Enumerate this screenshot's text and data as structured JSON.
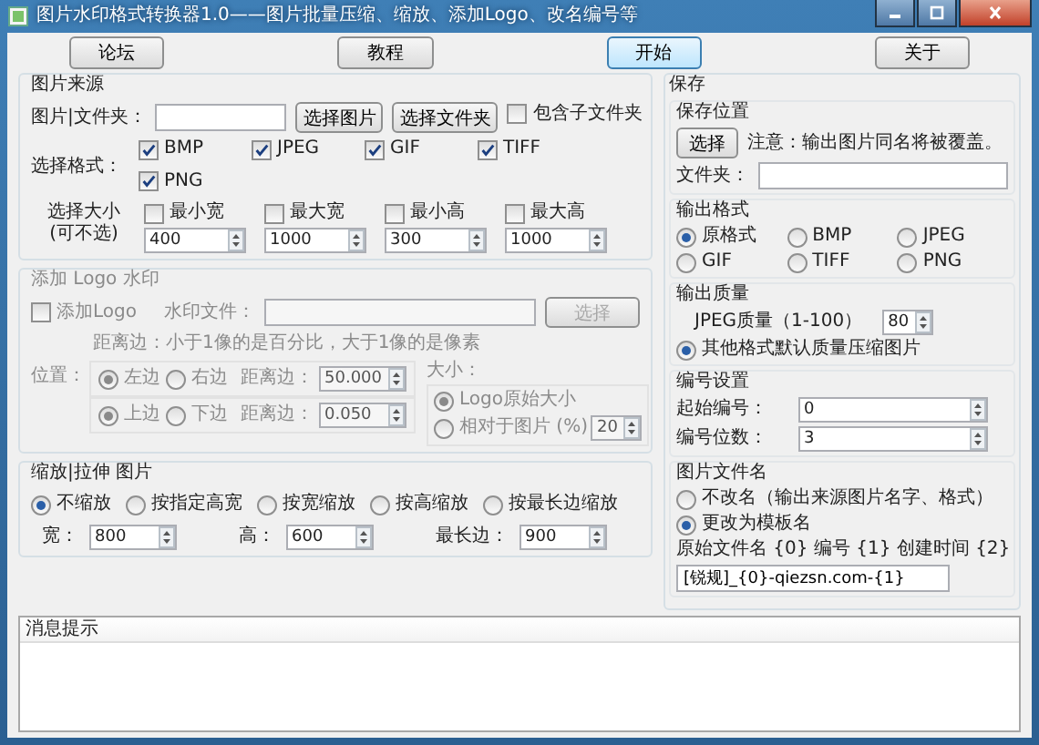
{
  "window": {
    "title": "图片水印格式转换器1.0——图片批量压缩、缩放、添加Logo、改名编号等"
  },
  "toolbar": [
    {
      "label": "论坛",
      "focused": false
    },
    {
      "label": "教程",
      "focused": false
    },
    {
      "label": "开始",
      "focused": true
    },
    {
      "label": "关于",
      "focused": false
    }
  ],
  "source": {
    "title": "图片来源",
    "path_label": "图片|文件夹：",
    "buttons": [
      "选择图片",
      "选择文件夹"
    ],
    "subfolders": {
      "label": "包含子文件夹",
      "checked": false
    },
    "format_label": "选择格式：",
    "formats": [
      {
        "label": "BMP",
        "checked": true
      },
      {
        "label": "JPEG",
        "checked": true
      },
      {
        "label": "GIF",
        "checked": true
      },
      {
        "label": "TIFF",
        "checked": true
      },
      {
        "label": "PNG",
        "checked": true
      }
    ],
    "size_label": "选择大小",
    "size_hint": "(可不选)",
    "sizes": [
      {
        "label": "最小宽",
        "checked": false,
        "value": "400"
      },
      {
        "label": "最大宽",
        "checked": false,
        "value": "1000"
      },
      {
        "label": "最小高",
        "checked": false,
        "value": "300"
      },
      {
        "label": "最大高",
        "checked": false,
        "value": "1000"
      }
    ]
  },
  "logo": {
    "title": "添加 Logo 水印",
    "disabled": true,
    "enable": {
      "label": "添加Logo",
      "checked": false
    },
    "file_label": "水印文件：",
    "button": "选择",
    "position_label": "位置：",
    "hint": "距离边：小于1像的是百分比，大于1像的是像素",
    "rows": [
      {
        "options": [
          {
            "label": "左边",
            "selected": true
          },
          {
            "label": "右边",
            "selected": false
          }
        ],
        "distance_label": "距离边：",
        "value": "50.000"
      },
      {
        "options": [
          {
            "label": "上边",
            "selected": true
          },
          {
            "label": "下边",
            "selected": false
          }
        ],
        "distance_label": "距离边：",
        "value": "0.050"
      }
    ],
    "size_label": "大小：",
    "size_options": [
      {
        "label": "Logo原始大小",
        "selected": true
      },
      {
        "label": "相对于图片 (%)",
        "selected": false
      }
    ],
    "size_value": "20"
  },
  "scale": {
    "title": "缩放|拉伸 图片",
    "modes": [
      {
        "label": "不缩放",
        "selected": true
      },
      {
        "label": "按指定高宽",
        "selected": false
      },
      {
        "label": "按宽缩放",
        "selected": false
      },
      {
        "label": "按高缩放",
        "selected": false
      },
      {
        "label": "按最长边缩放",
        "selected": false
      }
    ],
    "fields": [
      {
        "label": "宽：",
        "value": "800"
      },
      {
        "label": "高：",
        "value": "600"
      },
      {
        "label": "最长边：",
        "value": "900"
      }
    ]
  },
  "save": {
    "title": "保存",
    "location": {
      "title": "保存位置",
      "button": "选择",
      "note": "注意：输出图片同名将被覆盖。",
      "folder_label": "文件夹："
    },
    "output_format": {
      "title": "输出格式",
      "options": [
        {
          "label": "原格式",
          "selected": true
        },
        {
          "label": "BMP",
          "selected": false
        },
        {
          "label": "JPEG",
          "selected": false
        },
        {
          "label": "GIF",
          "selected": false
        },
        {
          "label": "TIFF",
          "selected": false
        },
        {
          "label": "PNG",
          "selected": false
        }
      ]
    },
    "quality": {
      "title": "输出质量",
      "jpeg_label": "JPEG质量（1-100）",
      "jpeg_value": "80",
      "other": {
        "label": "其他格式默认质量压缩图片",
        "selected": true
      }
    },
    "numbering": {
      "title": "编号设置",
      "fields": [
        {
          "label": "起始编号：",
          "value": "0"
        },
        {
          "label": "编号位数：",
          "value": "3"
        }
      ]
    },
    "filename": {
      "title": "图片文件名",
      "options": [
        {
          "label": "不改名（输出来源图片名字、格式）",
          "selected": false
        },
        {
          "label": "更改为模板名",
          "selected": true
        }
      ],
      "legend": "原始文件名 {0}  编号 {1}  创建时间 {2}",
      "template": "[锐规]_{0}-qiezsn.com-{1}"
    }
  },
  "messages": {
    "title": "消息提示"
  }
}
